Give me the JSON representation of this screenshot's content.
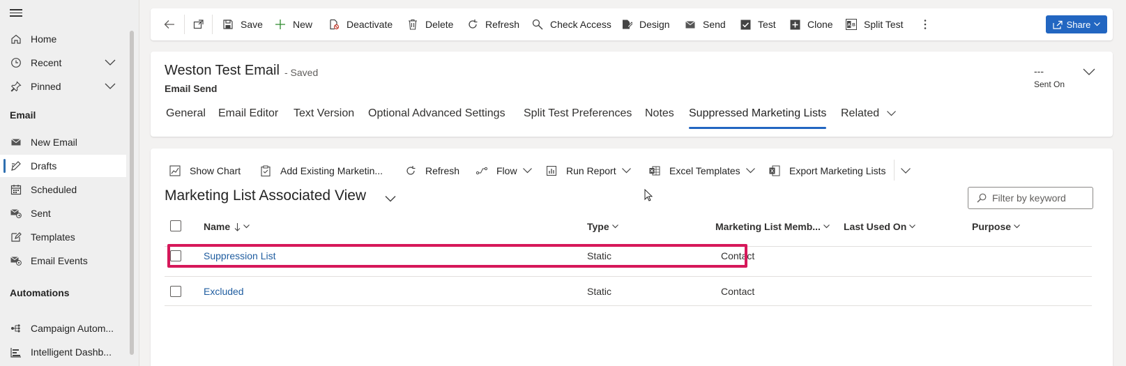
{
  "sidebar": {
    "items": [
      {
        "label": "Home",
        "icon": "home-icon"
      },
      {
        "label": "Recent",
        "icon": "clock-icon"
      },
      {
        "label": "Pinned",
        "icon": "pin-icon"
      }
    ],
    "section_email": "Email",
    "email_items": [
      {
        "label": "New Email",
        "icon": "mail-icon"
      },
      {
        "label": "Drafts",
        "icon": "edit-icon"
      },
      {
        "label": "Scheduled",
        "icon": "calendar-icon"
      },
      {
        "label": "Sent",
        "icon": "sent-mail-icon"
      },
      {
        "label": "Templates",
        "icon": "template-icon"
      },
      {
        "label": "Email Events",
        "icon": "email-events-icon"
      }
    ],
    "section_automations": "Automations",
    "automation_items": [
      {
        "label": "Campaign Autom...",
        "icon": "flow-icon"
      },
      {
        "label": "Intelligent Dashb...",
        "icon": "dashboard-icon"
      }
    ]
  },
  "commandbar": {
    "save": "Save",
    "new": "New",
    "deactivate": "Deactivate",
    "delete": "Delete",
    "refresh": "Refresh",
    "check_access": "Check Access",
    "design": "Design",
    "send": "Send",
    "test": "Test",
    "clone": "Clone",
    "split_test": "Split Test",
    "share": "Share"
  },
  "record": {
    "title": "Weston Test Email",
    "status": "- Saved",
    "entity": "Email Send",
    "sent_on_value": "---",
    "sent_on_label": "Sent On"
  },
  "tabs": [
    "General",
    "Email Editor",
    "Text Version",
    "Optional Advanced Settings",
    "Split Test Preferences",
    "Notes",
    "Suppressed Marketing Lists",
    "Related"
  ],
  "grid": {
    "commands": {
      "show_chart": "Show Chart",
      "add_existing": "Add Existing Marketin...",
      "refresh": "Refresh",
      "flow": "Flow",
      "run_report": "Run Report",
      "excel_templates": "Excel Templates",
      "export": "Export Marketing Lists"
    },
    "view_title": "Marketing List Associated View",
    "filter_placeholder": "Filter by keyword",
    "columns": {
      "name": "Name",
      "type": "Type",
      "member_type": "Marketing List Memb...",
      "last_used": "Last Used On",
      "purpose": "Purpose"
    },
    "rows": [
      {
        "name": "Suppression List",
        "type": "Static",
        "member": "Contact"
      },
      {
        "name": "Excluded",
        "type": "Static",
        "member": "Contact"
      }
    ]
  },
  "colors": {
    "accent": "#2266c1",
    "highlight": "#d6185a",
    "link": "#1e5c9f"
  }
}
